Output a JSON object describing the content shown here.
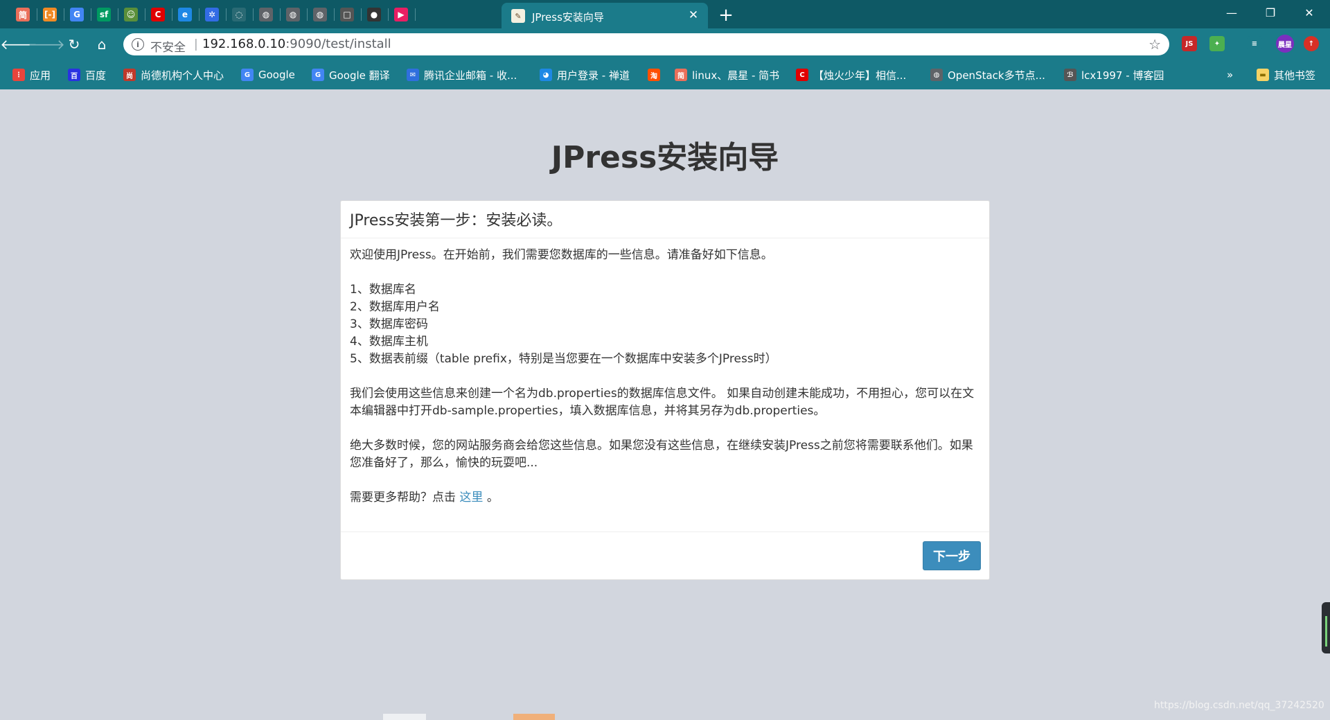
{
  "browser": {
    "active_tab_title": "JPress安装向导",
    "pinned_tabs": [
      {
        "icon": "jianshu-icon",
        "glyph": "简",
        "color": "#ea6f5a"
      },
      {
        "icon": "bracket-icon",
        "glyph": "[-]",
        "color": "#f08a24"
      },
      {
        "icon": "google-translate-icon",
        "glyph": "G",
        "color": "#4285f4"
      },
      {
        "icon": "segmentfault-icon",
        "glyph": "sf",
        "color": "#009a61"
      },
      {
        "icon": "avatar-icon",
        "glyph": "☺",
        "color": "#5a8f3a"
      },
      {
        "icon": "csdn-icon",
        "glyph": "C",
        "color": "#e00000"
      },
      {
        "icon": "edge-icon",
        "glyph": "e",
        "color": "#1e88e5"
      },
      {
        "icon": "kubernetes-icon",
        "glyph": "✲",
        "color": "#326ce5"
      },
      {
        "icon": "faded-icon",
        "glyph": "◌",
        "color": "#2a6a74"
      },
      {
        "icon": "globe-icon",
        "glyph": "◍",
        "color": "#5f6368"
      },
      {
        "icon": "globe-icon",
        "glyph": "◍",
        "color": "#5f6368"
      },
      {
        "icon": "globe-icon",
        "glyph": "◍",
        "color": "#5f6368"
      },
      {
        "icon": "book-icon",
        "glyph": "□",
        "color": "#555"
      },
      {
        "icon": "pot-icon",
        "glyph": "●",
        "color": "#333"
      },
      {
        "icon": "play-icon",
        "glyph": "▶",
        "color": "#e91e63"
      }
    ],
    "new_tab_glyph": "+",
    "window_controls": {
      "minimize": "—",
      "restore": "❐",
      "close": "✕"
    },
    "address_bar": {
      "security_label": "不安全",
      "separator": "|",
      "url_host": "192.168.0.10",
      "url_rest": ":9090/test/install"
    },
    "extensions": [
      {
        "icon": "js-extension-icon",
        "glyph": "JS",
        "color": "#c62828"
      },
      {
        "icon": "puzzle-extension-icon",
        "glyph": "✦",
        "color": "#4caf50"
      },
      {
        "icon": "reading-list-icon",
        "glyph": "≡",
        "color": "#1b7b8a"
      },
      {
        "icon": "profile-avatar-icon",
        "glyph": "晨星",
        "color": "#7b2fbf"
      },
      {
        "icon": "update-icon",
        "glyph": "↑",
        "color": "#d93025"
      }
    ],
    "bookmarks": [
      {
        "label": "应用",
        "icon": "apps-icon",
        "color": "#e8453c",
        "glyph": "⋮"
      },
      {
        "label": "百度",
        "icon": "baidu-icon",
        "color": "#2932e1",
        "glyph": "百"
      },
      {
        "label": "尚德机构个人中心",
        "icon": "sunlands-icon",
        "color": "#c0392b",
        "glyph": "尚"
      },
      {
        "label": "Google",
        "icon": "google-icon",
        "color": "#4285f4",
        "glyph": "G"
      },
      {
        "label": "Google 翻译",
        "icon": "google-translate-icon",
        "color": "#4285f4",
        "glyph": "G"
      },
      {
        "label": "腾讯企业邮箱 - 收...",
        "icon": "tencent-mail-icon",
        "color": "#2f6fde",
        "glyph": "✉"
      },
      {
        "label": "用户登录 - 禅道",
        "icon": "zentao-icon",
        "color": "#1e88e5",
        "glyph": "◕"
      },
      {
        "label": "",
        "icon": "taobao-icon",
        "color": "#ff5000",
        "glyph": "淘"
      },
      {
        "label": "linux、晨星 - 简书",
        "icon": "jianshu-icon",
        "color": "#ea6f5a",
        "glyph": "简"
      },
      {
        "label": "【烛火少年】相信...",
        "icon": "csdn-icon",
        "color": "#e00000",
        "glyph": "C"
      },
      {
        "label": "OpenStack多节点...",
        "icon": "globe-icon",
        "color": "#5f6368",
        "glyph": "◍"
      },
      {
        "label": "lcx1997 - 博客园",
        "icon": "cnblogs-icon",
        "color": "#555",
        "glyph": "ℬ"
      }
    ],
    "bookmarks_overflow": "»",
    "other_bookmarks": "其他书签"
  },
  "page": {
    "title": "JPress安装向导",
    "panel": {
      "heading": "JPress安装第一步：安装必读。",
      "intro": "欢迎使用JPress。在开始前，我们需要您数据库的一些信息。请准备好如下信息。",
      "items": [
        "1、数据库名",
        "2、数据库用户名",
        "3、数据库密码",
        "4、数据库主机",
        "5、数据表前缀（table prefix，特别是当您要在一个数据库中安装多个JPress时）"
      ],
      "para_create": "我们会使用这些信息来创建一个名为db.properties的数据库信息文件。 如果自动创建未能成功，不用担心，您可以在文本编辑器中打开db-sample.properties，填入数据库信息，并将其另存为db.properties。",
      "para_host": "绝大多数时候，您的网站服务商会给您这些信息。如果您没有这些信息，在继续安装JPress之前您将需要联系他们。如果您准备好了，那么，愉快的玩耍吧...",
      "help_prefix": "需要更多帮助？点击",
      "help_link": "这里",
      "help_suffix": "。",
      "next_button": "下一步"
    }
  },
  "watermark": "https://blog.csdn.net/qq_37242520"
}
